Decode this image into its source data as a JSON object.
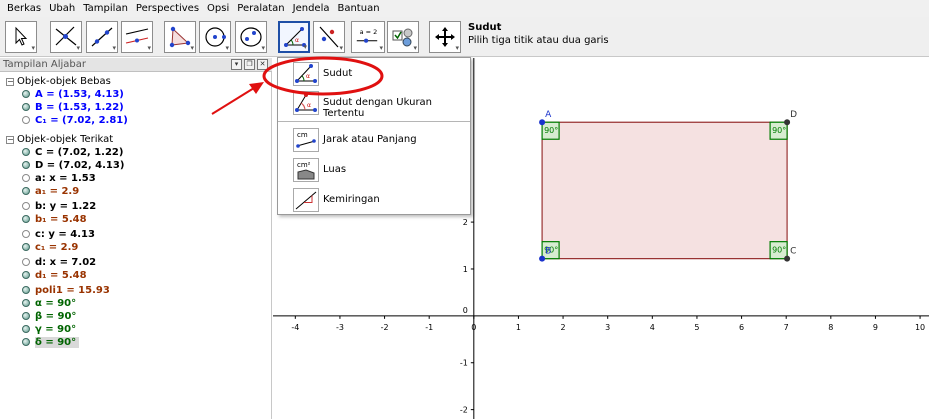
{
  "menu": [
    "Berkas",
    "Ubah",
    "Tampilan",
    "Perspectives",
    "Opsi",
    "Peralatan",
    "Jendela",
    "Bantuan"
  ],
  "toolbar": {
    "active_tool_title": "Sudut",
    "active_tool_desc": "Pilih tiga titik atau dua garis",
    "tools": [
      "move",
      "point",
      "line",
      "perpendicular",
      "polygon",
      "circle",
      "conic",
      "angle",
      "reflect",
      "slider",
      "checkbox",
      "move-graphics"
    ],
    "slider_label": "a = 2"
  },
  "algebra": {
    "title": "Tampilan Aljabar",
    "free_group": "Objek-objek Bebas",
    "dependent_group": "Objek-objek Terikat",
    "free": [
      {
        "text": "A = (1.53, 4.13)",
        "color": "#0000ff",
        "shown": true
      },
      {
        "text": "B = (1.53, 1.22)",
        "color": "#0000ff",
        "shown": true
      },
      {
        "text": "C₁ = (7.02, 2.81)",
        "color": "#0000ff",
        "shown": false
      }
    ],
    "dependent": [
      {
        "text": "C = (7.02, 1.22)",
        "color": "#000000",
        "shown": true
      },
      {
        "text": "D = (7.02, 4.13)",
        "color": "#000000",
        "shown": true
      },
      {
        "text": "a: x = 1.53",
        "color": "#000000",
        "shown": false
      },
      {
        "text": "a₁ = 2.9",
        "color": "#993300",
        "shown": true
      },
      {
        "text": "b: y = 1.22",
        "color": "#000000",
        "shown": false
      },
      {
        "text": "b₁ = 5.48",
        "color": "#993300",
        "shown": true
      },
      {
        "text": "c: y = 4.13",
        "color": "#000000",
        "shown": false
      },
      {
        "text": "c₁ = 2.9",
        "color": "#993300",
        "shown": true
      },
      {
        "text": "d: x = 7.02",
        "color": "#000000",
        "shown": false
      },
      {
        "text": "d₁ = 5.48",
        "color": "#993300",
        "shown": true
      },
      {
        "text": "poli1 = 15.93",
        "color": "#993300",
        "shown": true
      },
      {
        "text": "α = 90°",
        "color": "#006400",
        "shown": true
      },
      {
        "text": "β = 90°",
        "color": "#006400",
        "shown": true
      },
      {
        "text": "γ = 90°",
        "color": "#006400",
        "shown": true
      },
      {
        "text": "δ = 90°",
        "color": "#006400",
        "shown": true,
        "highlighted": true
      }
    ]
  },
  "dropdown": {
    "items": [
      {
        "label": "Sudut",
        "icon": "angle-icon"
      },
      {
        "label": "Sudut dengan Ukuran Tertentu",
        "icon": "angle-fixed-icon"
      },
      {
        "label": "Jarak atau Panjang",
        "icon": "distance-icon",
        "icon_text": "cm"
      },
      {
        "label": "Luas",
        "icon": "area-icon",
        "icon_text": "cm²"
      },
      {
        "label": "Kemiringan",
        "icon": "slope-icon"
      }
    ]
  },
  "graph": {
    "xmin": -4.5,
    "xmax": 10.2,
    "ymin": -2.2,
    "ymax": 5.5,
    "x_ticks": [
      -4,
      -3,
      -2,
      -1,
      0,
      1,
      2,
      3,
      4,
      5,
      6,
      7,
      8,
      9,
      10
    ],
    "y_ticks": [
      -2,
      -1,
      0,
      1,
      2
    ],
    "rectangle": [
      [
        1.53,
        4.13
      ],
      [
        7.02,
        4.13
      ],
      [
        7.02,
        1.22
      ],
      [
        1.53,
        1.22
      ]
    ],
    "points": [
      {
        "name": "A",
        "x": 1.53,
        "y": 4.13,
        "color": "#1a33cc"
      },
      {
        "name": "B",
        "x": 1.53,
        "y": 1.22,
        "color": "#1a33cc"
      },
      {
        "name": "C",
        "x": 7.02,
        "y": 1.22,
        "color": "#333333"
      },
      {
        "name": "D",
        "x": 7.02,
        "y": 4.13,
        "color": "#333333"
      }
    ],
    "angle_label": "90°",
    "fill_color": "#f5e1e1",
    "edge_color": "#993333",
    "angle_color": "#007d00"
  }
}
